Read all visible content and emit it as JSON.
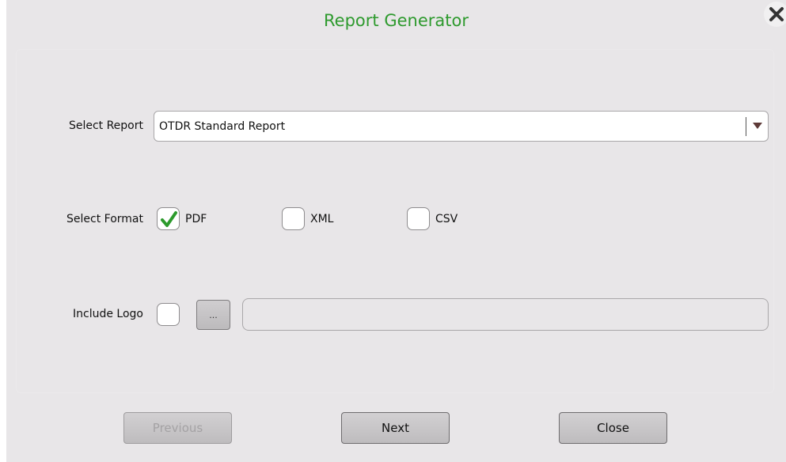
{
  "dialog": {
    "title": "Report Generator",
    "close_icon": "close-icon"
  },
  "report": {
    "label": "Select Report",
    "selected": "OTDR Standard Report",
    "arrow_icon": "chevron-down-icon"
  },
  "format": {
    "label": "Select Format",
    "options": [
      {
        "label": "PDF",
        "checked": true
      },
      {
        "label": "XML",
        "checked": false
      },
      {
        "label": "CSV",
        "checked": false
      }
    ],
    "check_icon": "checkmark-icon"
  },
  "logo": {
    "label": "Include Logo",
    "checked": false,
    "browse_label": "...",
    "path_value": ""
  },
  "footer": {
    "previous_label": "Previous",
    "previous_enabled": false,
    "next_label": "Next",
    "close_label": "Close"
  },
  "colors": {
    "title": "#2e9a2e",
    "check": "#2c9a2c",
    "background": "#e8e6e8"
  }
}
